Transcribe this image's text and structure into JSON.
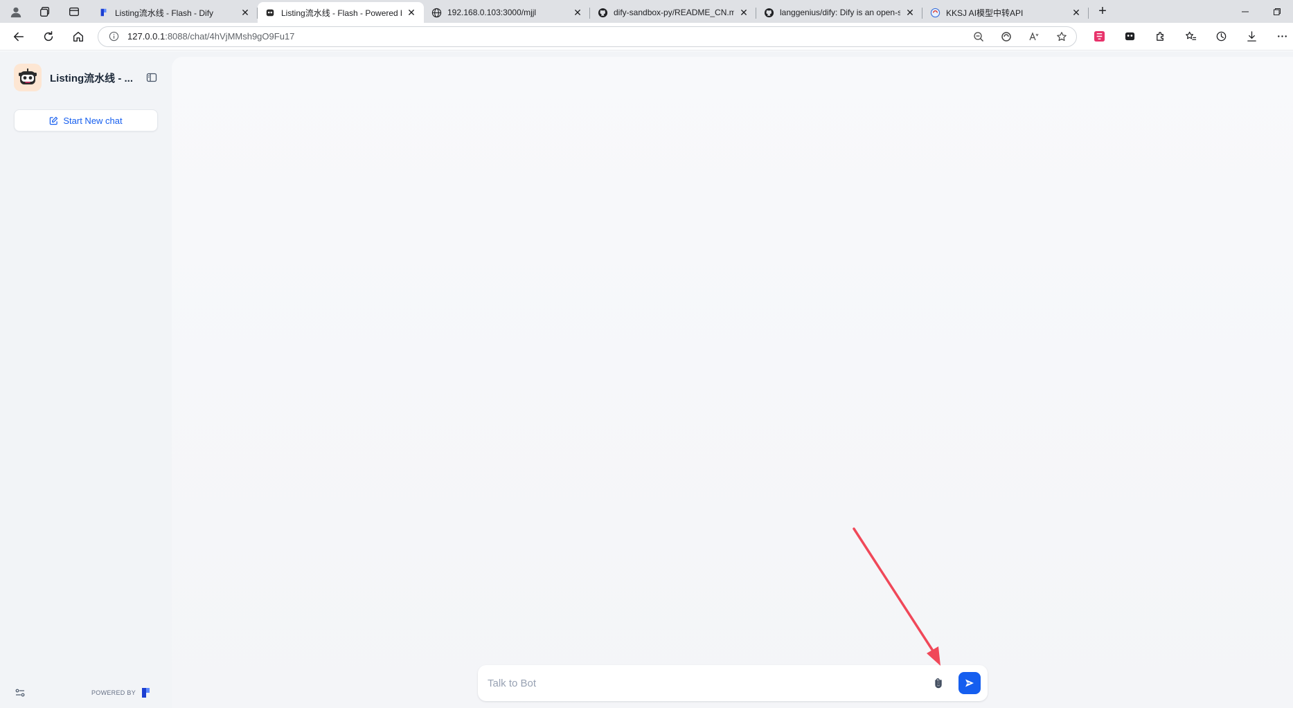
{
  "browser": {
    "tabs": [
      {
        "title": "Listing流水线 - Flash - Dify",
        "active": false,
        "favicon": "dify-icon"
      },
      {
        "title": "Listing流水线 - Flash - Powered b",
        "active": true,
        "favicon": "bot-icon"
      },
      {
        "title": "192.168.0.103:3000/mjjl",
        "active": false,
        "favicon": "globe-icon"
      },
      {
        "title": "dify-sandbox-py/README_CN.md",
        "active": false,
        "favicon": "github-icon"
      },
      {
        "title": "langgenius/dify: Dify is an open-s",
        "active": false,
        "favicon": "github-icon"
      },
      {
        "title": "KKSJ AI模型中转API",
        "active": false,
        "favicon": "kksj-icon"
      }
    ],
    "tab_close_glyph": "✕",
    "new_tab_glyph": "+",
    "address": {
      "host": "127.0.0.1",
      "path": ":8088/chat/4hVjMMsh9gO9Fu17"
    }
  },
  "sidebar": {
    "app_name": "Listing流水线 - ...",
    "new_chat_label": "Start New chat",
    "powered_by": "POWERED BY"
  },
  "chat": {
    "placeholder": "Talk to Bot"
  },
  "colors": {
    "accent": "#155eef",
    "annotation_arrow": "#f04859"
  }
}
